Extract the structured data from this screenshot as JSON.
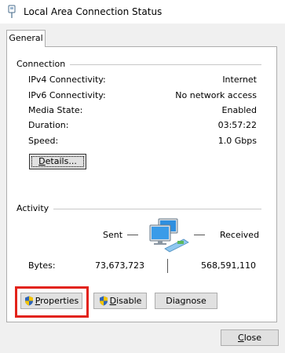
{
  "window": {
    "title": "Local Area Connection Status",
    "icon": "network-adapter-icon"
  },
  "tabs": [
    {
      "label": "General"
    }
  ],
  "connection": {
    "heading": "Connection",
    "rows": [
      {
        "label": "IPv4 Connectivity:",
        "value": "Internet"
      },
      {
        "label": "IPv6 Connectivity:",
        "value": "No network access"
      },
      {
        "label": "Media State:",
        "value": "Enabled"
      },
      {
        "label": "Duration:",
        "value": "03:57:22"
      },
      {
        "label": "Speed:",
        "value": "1.0 Gbps"
      }
    ],
    "details_button": {
      "mnemonic": "D",
      "rest": "etails..."
    }
  },
  "activity": {
    "heading": "Activity",
    "sent_label": "Sent",
    "received_label": "Received",
    "bytes_label": "Bytes:",
    "bytes_sent": "73,673,723",
    "bytes_received": "568,591,110",
    "icon": "network-computers-icon"
  },
  "buttons": {
    "properties": {
      "mnemonic": "P",
      "rest": "roperties",
      "icon": "uac-shield-icon"
    },
    "disable": {
      "mnemonic": "D",
      "rest": "isable",
      "icon": "uac-shield-icon"
    },
    "diagnose": {
      "prefix": "Dia",
      "mnemonic": "g",
      "rest": "nose"
    },
    "close": {
      "mnemonic": "C",
      "rest": "lose"
    }
  },
  "colors": {
    "highlight": "#e2231a",
    "button_face": "#e1e1e1",
    "dialog_bg": "#f0f0f0"
  }
}
